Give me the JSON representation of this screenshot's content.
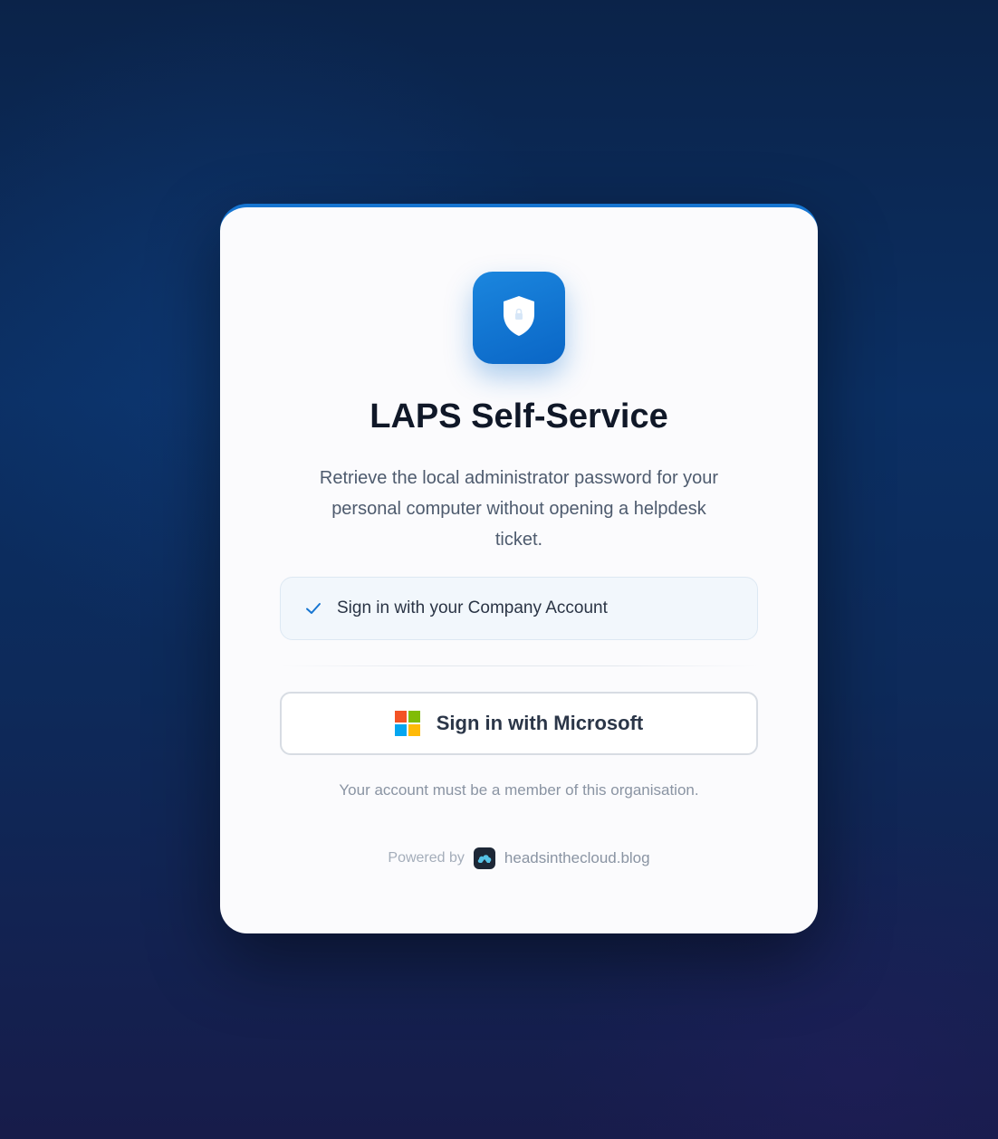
{
  "app": {
    "title": "LAPS Self-Service",
    "description": "Retrieve the local administrator password for your personal computer without opening a helpdesk ticket."
  },
  "logo": {
    "icon": "shield-lock-icon"
  },
  "info": {
    "icon": "checkmark-icon",
    "text": "Sign in with your Company Account"
  },
  "signin": {
    "icon": "microsoft-logo-icon",
    "label": "Sign in with Microsoft"
  },
  "note": "Your account must be a member of this organisation.",
  "footer": {
    "powered_by": "Powered by",
    "icon": "cloud-blog-icon",
    "link_text": "headsinthecloud.blog"
  },
  "colors": {
    "accent": "#1675d1",
    "background_top": "#0b2349",
    "background_bottom": "#171c4a",
    "card": "#fbfbfd",
    "ms_red": "#f35325",
    "ms_green": "#81bc06",
    "ms_blue": "#05a6f0",
    "ms_yellow": "#ffba08"
  }
}
